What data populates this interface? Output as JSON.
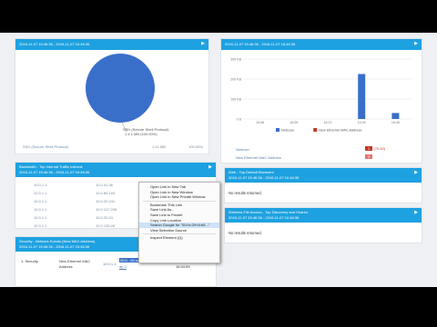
{
  "colors": {
    "accent": "#1ea1e0",
    "series_primary": "#3a6fc9",
    "series_secondary": "#c0392b",
    "badge": "#c0392b"
  },
  "pie_panel": {
    "title": "2016-11-07 15:46:36 - 2016-11-07 16:46:36",
    "slice_label_1": "SSH (Secure Shell Protocol)",
    "slice_label_2": "1.4 1 MB (100.00%)",
    "row": {
      "name": "SSH (Secure Shell Protocol)",
      "size": "1.41 MB",
      "percent": "100.00%"
    }
  },
  "chart_panel": {
    "title": "2016-11-07 15:46:36 - 2016-11-07 16:46:36",
    "rows": [
      {
        "name": "Netscan",
        "count": "1",
        "pct": "(70.00)"
      },
      {
        "name": "New Ethernet MAC Address",
        "count": "2",
        "pct": ""
      }
    ]
  },
  "chart_data": {
    "type": "bar",
    "categories": [
      "15:58",
      "16:05",
      "16:21",
      "16:30",
      "16:45"
    ],
    "series": [
      {
        "name": "Netscan",
        "values": [
          0,
          0,
          0,
          225,
          30
        ]
      },
      {
        "name": "New Ethernet MAC Address",
        "values": [
          0,
          0,
          0,
          0,
          0
        ]
      }
    ],
    "ytick_labels": [
      "300 KB",
      "200 KB",
      "100 KB",
      "0 B"
    ],
    "ylim": [
      0,
      300
    ],
    "legend": "bottom",
    "grid": true
  },
  "bandwidth_panel": {
    "title": "Bandwidth - Top Internal Traffic Internal",
    "subtitle": "2016-11-07 15:46:36 - 2016-11-07 16:46:36",
    "rows": [
      {
        "src": "10.0.1.1",
        "dst": "10.0.41.36"
      },
      {
        "src": "10.0.1.1",
        "dst": "10.0.80.154"
      },
      {
        "src": "10.0.1.1",
        "dst": "10.0.20.241"
      },
      {
        "src": "10.0.1.1",
        "dst": "10.0.117.208"
      },
      {
        "src": "10.0.1.1",
        "dst": "10.0.20.24"
      },
      {
        "src": "10.0.1.1",
        "dst": "10.0.135.28"
      }
    ]
  },
  "security_panel": {
    "title": "Security - Network Events (New MAC Address)",
    "subtitle": "2016-11-07 15:46:36 - 2016-11-07 16:46:36",
    "row": {
      "idx": "1",
      "type": "Security",
      "event": "New Ethernet MAC",
      "event2": "Address",
      "ip": "10.0.1.1",
      "time1": "16:04:19",
      "time2": "16:34:59",
      "link": "00:0...26 a4",
      "link2": "ap 2"
    }
  },
  "top_panel": {
    "title": "Web - Top Default Browsers",
    "subtitle": "2016-11-07 15:46:36 - 2016-11-07 16:46:36",
    "empty": "No results returned."
  },
  "wireless_panel": {
    "title": "Wireless File Access - Top Discovery and Shares",
    "subtitle": "2016-11-07 15:46:36 - 2016-11-07 16:46:36",
    "empty": "No results returned."
  },
  "context_menu": {
    "items": [
      "Open Link in New Tab",
      "Open Link in New Window",
      "Open Link in New Private Window",
      "Bookmark This Link",
      "Save Link As...",
      "Save Link to Pocket",
      "Copy Link Location",
      "Search Google for \"00:0c:29:f4:b5...\"",
      "View Selection Source",
      "Inspect Element (Q)"
    ]
  }
}
